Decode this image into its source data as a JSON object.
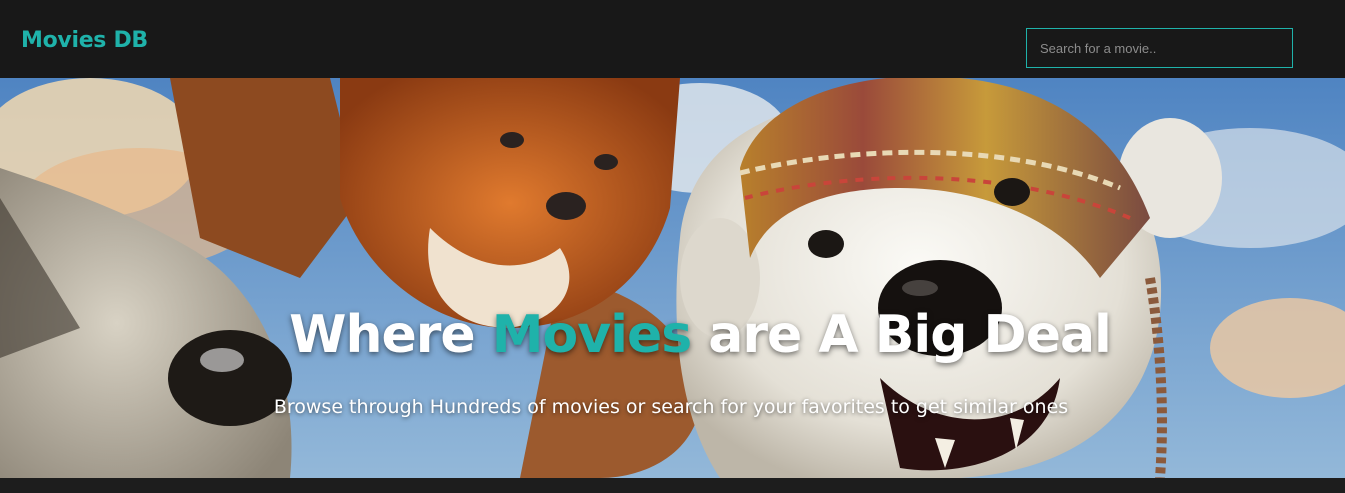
{
  "navbar": {
    "brand": "Movies DB",
    "search_placeholder": "Search for a movie.."
  },
  "hero": {
    "title_before": "Where",
    "title_accent": "Movies",
    "title_after": "are A Big Deal",
    "subtitle": "Browse through Hundreds of movies or search for your favorites to get similar ones"
  },
  "colors": {
    "accent": "#1fb2aa",
    "navbar_bg": "#181818",
    "page_bg": "#1d1d1d"
  }
}
